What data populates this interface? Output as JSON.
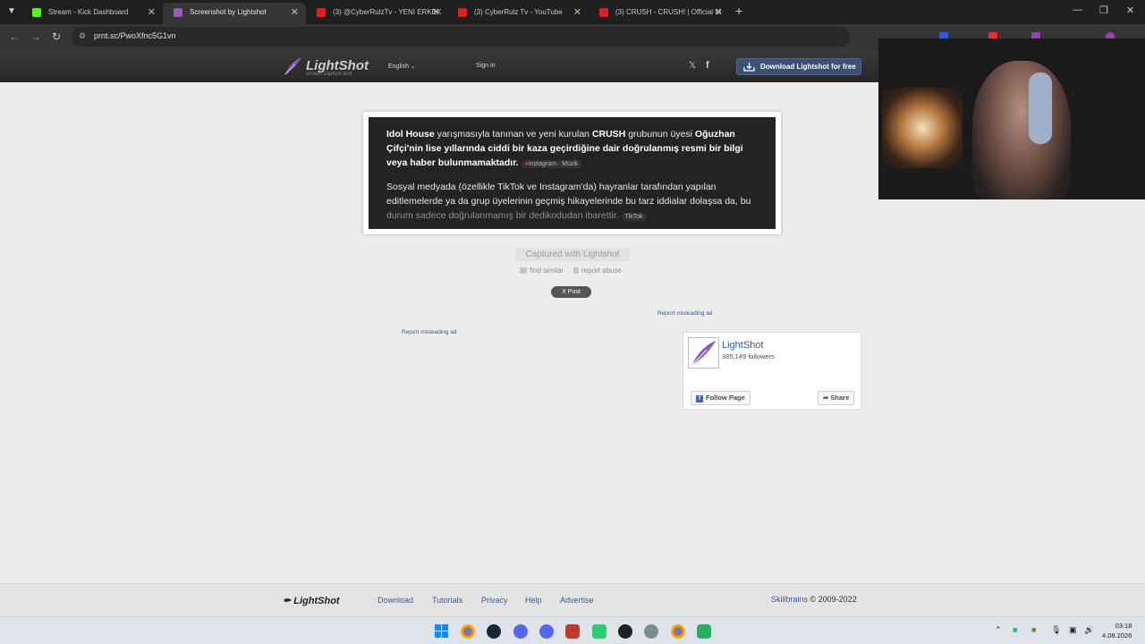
{
  "browser": {
    "tabs": [
      {
        "title": "Stream - Kick Dashboard",
        "favicon": "kick-icon",
        "color": "#53fc18"
      },
      {
        "title": "Screenshot by Lightshot",
        "favicon": "lightshot-icon",
        "color": "#9b59b6"
      },
      {
        "title": "(3) @CyberRulzTv - YENİ ERKEK",
        "favicon": "youtube-icon",
        "color": "#ff0000"
      },
      {
        "title": "(3) CyberRulz Tv - YouTube",
        "favicon": "youtube-icon",
        "color": "#ff0000"
      },
      {
        "title": "(3) CRUSH - CRUSH! | Official M",
        "favicon": "youtube-icon",
        "color": "#ff0000"
      }
    ],
    "active_tab": 1,
    "url": "prnt.sc/PwoXfnc5G1vn"
  },
  "header": {
    "logo": "LightShot",
    "logo_sub": "screen capture tool",
    "language": "English",
    "sign_in": "Sign in",
    "download": "Download Lightshot for free",
    "accent": "#3c4f75"
  },
  "screenshot": {
    "p1_a": "Idol House",
    "p1_b": " yarışmasıyla tanınan ve yeni kurulan ",
    "p1_c": "CRUSH",
    "p1_d": " grubunun üyesi ",
    "p1_e": "Oğuzhan Çifçi'nin lise yıllarında ciddi bir kaza geçirdiğine dair doğrulanmış resmi bir bilgi veya haber bulunmamaktadır.",
    "p1_chip": "Instagram · Müzik",
    "p2_a": "Sosyal medyada (özellikle TikTok ve Instagram'da) hayranlar tarafından yapılan editlemelerde ya da grup üyelerinin geçmiş hikayelerinde bu tarz iddialar dolaşsa da, bu ",
    "p2_b": "durum sadece doğrulanmamış bir dedikodudan ibarettir.",
    "p2_chip": "TikTok"
  },
  "captured": "Captured with Lightshot",
  "find_similar": "find similar",
  "report_abuse": "report abuse",
  "x_post": "X Post",
  "report_ad": "Report misleading ad",
  "facebook": {
    "name": "LightShot",
    "followers": "385,149 followers",
    "follow": "Follow Page",
    "share": "Share"
  },
  "footer": {
    "logo": "LightShot",
    "links": [
      "Download",
      "Tutorials",
      "Privacy",
      "Help",
      "Advertise"
    ],
    "company": "Skillbrains",
    "copyright": "© 2009-2022"
  },
  "taskbar": {
    "time": "03:18",
    "date": "4.08.2026"
  }
}
